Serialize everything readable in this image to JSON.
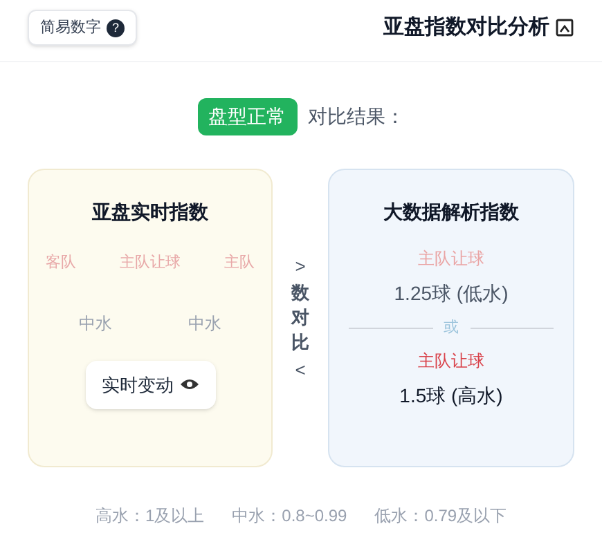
{
  "header": {
    "title": "亚盘指数对比分析",
    "help_button": {
      "label": "简易数字",
      "icon": "?"
    }
  },
  "result": {
    "label": "对比结果：",
    "badge": "盘型正常"
  },
  "live_card": {
    "title": "亚盘实时指数",
    "columns": [
      "客队",
      "主队让球",
      "主队"
    ],
    "water_levels": [
      "中水",
      "中水"
    ],
    "button": "实时变动"
  },
  "compare_divider": {
    "text": "数对比",
    "arrow_top": ">",
    "arrow_bottom": "<"
  },
  "analysis_card": {
    "title": "大数据解析指数",
    "options": [
      {
        "label": "主队让球",
        "value": "1.25球 (低水)",
        "highlighted": false
      },
      {
        "label": "主队让球",
        "value": "1.5球 (高水)",
        "highlighted": true
      }
    ],
    "separator": "或"
  },
  "legend": [
    "高水：1及以上",
    "中水：0.8~0.99",
    "低水：0.79及以下"
  ]
}
